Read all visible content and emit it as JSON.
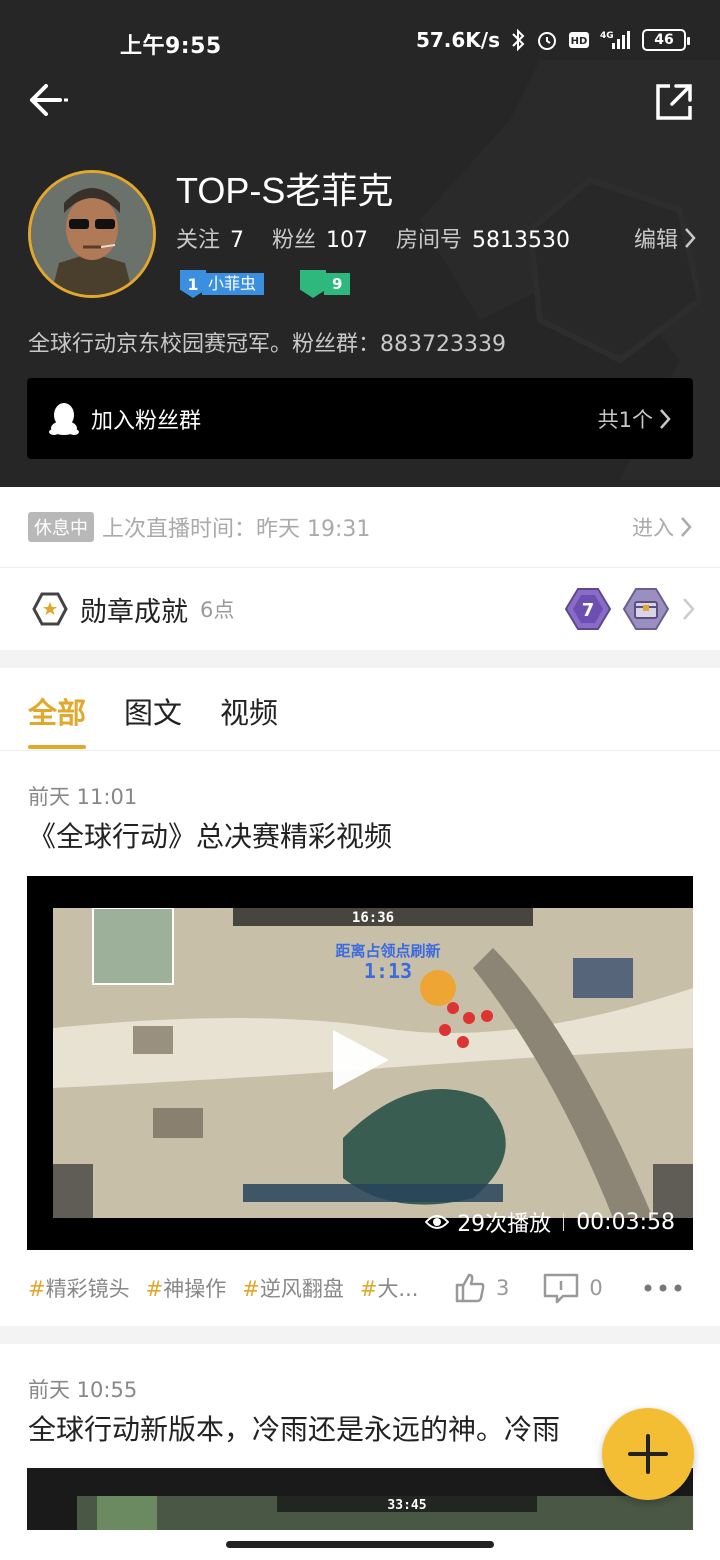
{
  "status_bar": {
    "time": "上午9:55",
    "network_speed": "57.6K/s",
    "battery": "46"
  },
  "profile": {
    "username": "TOP-S老菲克",
    "follow_label": "关注",
    "follow_count": "7",
    "fans_label": "粉丝",
    "fans_count": "107",
    "room_label": "房间号",
    "room_number": "5813530",
    "edit_label": "编辑",
    "level_badge_num": "1",
    "level_badge_text": "小菲虫",
    "fan_badge_num": "9",
    "bio": "全球行动京东校园赛冠军。粉丝群：883723339"
  },
  "fan_group": {
    "label": "加入粉丝群",
    "count": "共1个"
  },
  "live_status": {
    "tag": "休息中",
    "last_live": "上次直播时间：昨天 19:31",
    "enter_label": "进入"
  },
  "medals": {
    "title": "勋章成就",
    "points": "6点",
    "medal_level": "7"
  },
  "tabs": [
    {
      "label": "全部",
      "active": true
    },
    {
      "label": "图文",
      "active": false
    },
    {
      "label": "视频",
      "active": false
    }
  ],
  "posts": [
    {
      "date": "前天 11:01",
      "title": "《全球行动》总决赛精彩视频",
      "play_count": "29次播放",
      "duration": "00:03:58",
      "game_timer": "16:36",
      "game_banner": "距离占领点刷新",
      "game_countdown": "1:13",
      "tags": [
        "精彩镜头",
        "神操作",
        "逆风翻盘",
        "大..."
      ],
      "likes": "3",
      "comments": "0"
    },
    {
      "date": "前天 10:55",
      "title": "全球行动新版本，冷雨还是永远的神。冷雨",
      "game_timer": "33:45"
    }
  ],
  "colors": {
    "accent": "#e3a82b",
    "header_bg": "#262626",
    "fab": "#f4be34"
  }
}
